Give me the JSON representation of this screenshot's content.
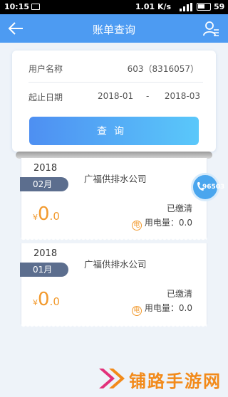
{
  "status_bar": {
    "time": "10:15",
    "network": "1.01 K/s",
    "battery": "59"
  },
  "nav": {
    "title": "账单查询"
  },
  "query": {
    "user_label": "用户名称",
    "user_value": "603（8316057）",
    "date_label": "起止日期",
    "date_start": "2018-01",
    "date_sep": "-",
    "date_end": "2018-03",
    "button_label": "查询"
  },
  "bills": [
    {
      "year": "2018",
      "month": "02月",
      "company": "广福供排水公司",
      "status": "已缴清",
      "currency": "¥",
      "amount_int": "0",
      "amount_dec": ".0",
      "usage_icon": "电",
      "usage": "用电量：0.0"
    },
    {
      "year": "2018",
      "month": "01月",
      "company": "广福供排水公司",
      "status": "已缴清",
      "currency": "¥",
      "amount_int": "0",
      "amount_dec": ".0",
      "usage_icon": "电",
      "usage": "用电量：0.0"
    }
  ],
  "hotline": {
    "number": "96503"
  },
  "watermark": {
    "text": "铺路手游网"
  },
  "colors": {
    "nav": "#4d9bf2",
    "accent_orange": "#f29a2e",
    "month_tag": "#5c6e8e"
  }
}
